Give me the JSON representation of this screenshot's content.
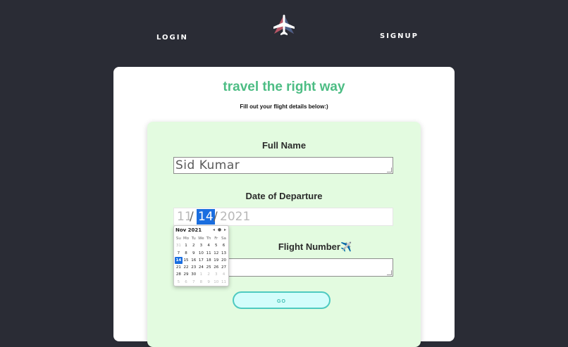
{
  "nav": {
    "login": "LOGIN",
    "signup": "SIGNUP"
  },
  "logo": {
    "icon": "airplane-icon"
  },
  "card": {
    "title": "travel the right way",
    "subtitle": "Fill out your flight details below:)"
  },
  "form": {
    "full_name": {
      "label": "Full Name",
      "value": "Sid Kumar"
    },
    "date_of_departure": {
      "label": "Date of Departure",
      "month": "11",
      "day": "14",
      "year": "2021",
      "separator": "/"
    },
    "flight_number": {
      "label": "Flight Number✈️",
      "value": ""
    },
    "go_label": "GO"
  },
  "calendar": {
    "month_label": "Nov 2021",
    "nav": "◂ ● ▸",
    "weekdays": [
      "Su",
      "Mo",
      "Tu",
      "We",
      "Th",
      "Fr",
      "Sa"
    ],
    "weeks": [
      [
        "31",
        "1",
        "2",
        "3",
        "4",
        "5",
        "6"
      ],
      [
        "7",
        "8",
        "9",
        "10",
        "11",
        "12",
        "13"
      ],
      [
        "14",
        "15",
        "16",
        "17",
        "18",
        "19",
        "20"
      ],
      [
        "21",
        "22",
        "23",
        "24",
        "25",
        "26",
        "27"
      ],
      [
        "28",
        "29",
        "30",
        "1",
        "2",
        "3",
        "4"
      ],
      [
        "5",
        "6",
        "7",
        "8",
        "9",
        "10",
        "11"
      ]
    ],
    "selected": "14"
  },
  "colors": {
    "background": "#2a2c35",
    "accent": "#4dbd84",
    "panel": "#e3fbe0",
    "button_border": "#4ecac0"
  }
}
